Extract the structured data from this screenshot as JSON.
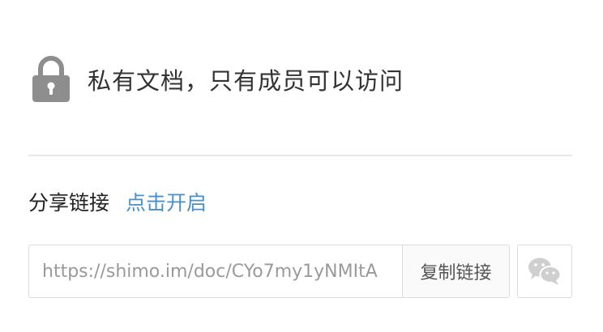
{
  "privacy": {
    "icon": "lock-icon",
    "text": "私有文档，只有成员可以访问"
  },
  "share": {
    "label": "分享链接",
    "enable_link": "点击开启",
    "link_value": "https://shimo.im/doc/CYo7my1yNMItA",
    "copy_label": "复制链接",
    "wechat_icon": "wechat-icon"
  },
  "colors": {
    "accent": "#4a90c9",
    "icon_gray": "#8e8e8e",
    "text": "#333333",
    "border": "#dcdcdc"
  }
}
